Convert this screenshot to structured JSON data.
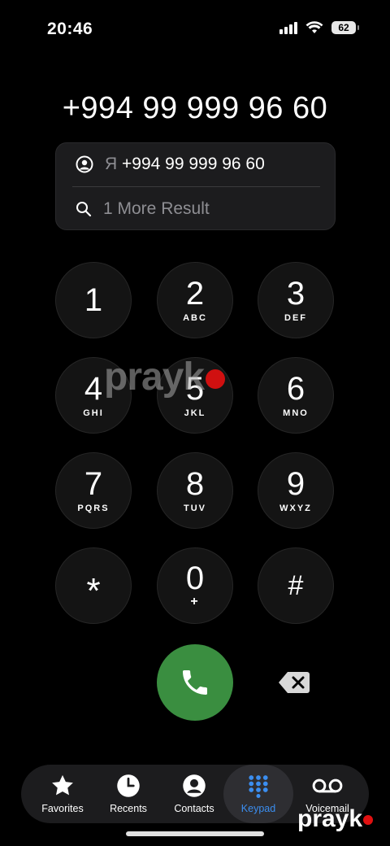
{
  "status": {
    "time": "20:46",
    "battery": "62"
  },
  "dialed_number": "+994 99 999 96 60",
  "suggestions": {
    "contact_initial": "Я",
    "contact_number": "+994 99 999 96 60",
    "more_results": "1 More Result"
  },
  "keypad": [
    {
      "digit": "1",
      "letters": ""
    },
    {
      "digit": "2",
      "letters": "ABC"
    },
    {
      "digit": "3",
      "letters": "DEF"
    },
    {
      "digit": "4",
      "letters": "GHI"
    },
    {
      "digit": "5",
      "letters": "JKL"
    },
    {
      "digit": "6",
      "letters": "MNO"
    },
    {
      "digit": "7",
      "letters": "PQRS"
    },
    {
      "digit": "8",
      "letters": "TUV"
    },
    {
      "digit": "9",
      "letters": "WXYZ"
    },
    {
      "digit": "*",
      "letters": ""
    },
    {
      "digit": "0",
      "letters": "+"
    },
    {
      "digit": "#",
      "letters": ""
    }
  ],
  "tabs": [
    {
      "label": "Favorites",
      "icon": "star-icon"
    },
    {
      "label": "Recents",
      "icon": "clock-icon"
    },
    {
      "label": "Contacts",
      "icon": "person-circle-icon"
    },
    {
      "label": "Keypad",
      "icon": "keypad-grid-icon",
      "active": true
    },
    {
      "label": "Voicemail",
      "icon": "voicemail-icon"
    }
  ],
  "watermark": "prayk",
  "colors": {
    "call_green": "#3a8e40",
    "active_blue": "#3b8ef0",
    "watermark_red": "#d01010"
  }
}
